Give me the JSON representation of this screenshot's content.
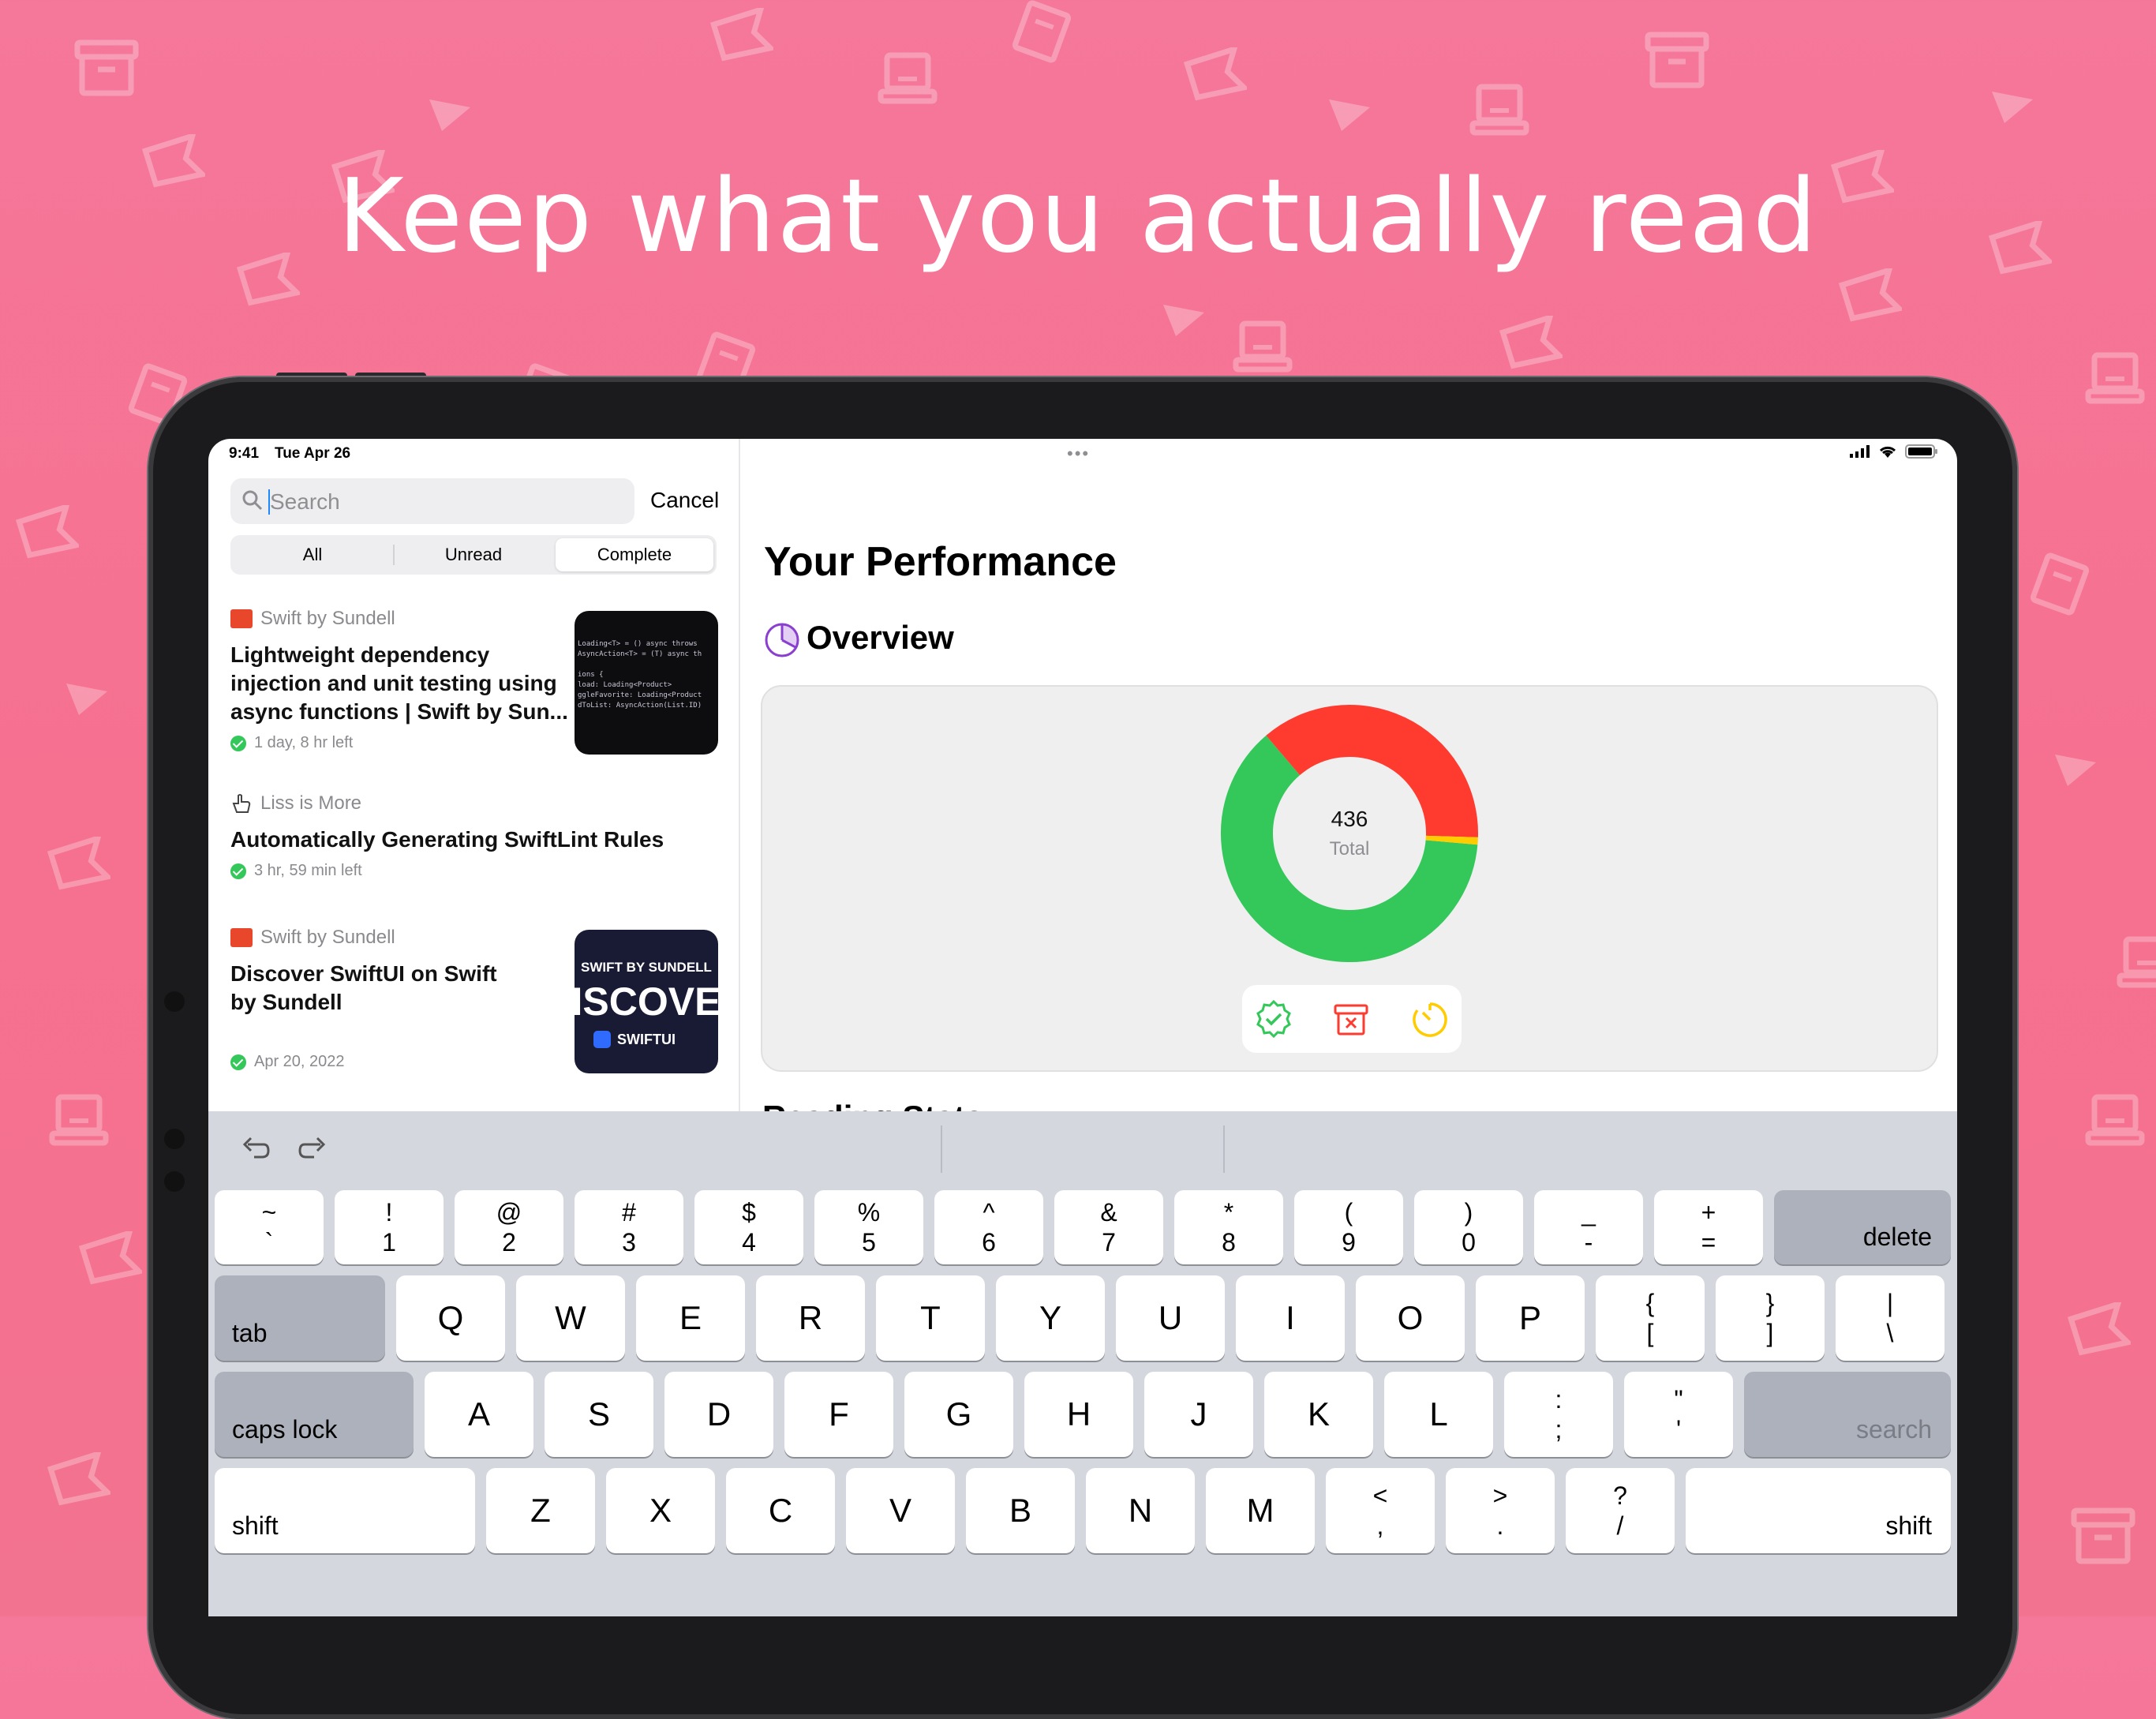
{
  "headline": "Keep what you actually read",
  "status_bar": {
    "time": "9:41",
    "date": "Tue Apr 26",
    "center_dots": "•••"
  },
  "search": {
    "placeholder": "Search",
    "cancel_label": "Cancel"
  },
  "segments": [
    {
      "label": "All",
      "active": false
    },
    {
      "label": "Unread",
      "active": false
    },
    {
      "label": "Complete",
      "active": true
    }
  ],
  "articles": [
    {
      "source": "Swift by Sundell",
      "title_lines": [
        "Lightweight dependency",
        "injection and unit testing using",
        "async functions | Swift by Sun..."
      ],
      "meta": "1 day, 8 hr left",
      "thumb_code": "Loading<T> = () async throws\nAsyncAction<T> = (T) async th\n\nions {\nload: Loading<Product>\nggleFavorite: Loading<Product\ndToList: AsyncAction(List.ID)"
    },
    {
      "source": "Liss is More",
      "title_lines": [
        "Automatically Generating SwiftLint Rules"
      ],
      "meta": "3 hr, 59 min left"
    },
    {
      "source": "Swift by Sundell",
      "title_lines": [
        "Discover SwiftUI on Swift",
        "by Sundell"
      ],
      "meta": "Apr 20, 2022",
      "thumb_top": "SWIFT BY SUNDELL",
      "thumb_big": "ISCOVE",
      "thumb_bottom": "SWIFTUI"
    }
  ],
  "detail": {
    "title": "Your Performance",
    "overview_title": "Overview",
    "donut_total": "436",
    "donut_label": "Total",
    "peek_title": "Reading Stats"
  },
  "chart_data": {
    "type": "pie",
    "categories": [
      "Completed",
      "Deleted",
      "Expired"
    ],
    "values": [
      272,
      160,
      4
    ],
    "total": 436,
    "colors": [
      "#34c759",
      "#ff3b30",
      "#ffcc00"
    ]
  },
  "keyboard": {
    "number_row": [
      {
        "top": "~",
        "bottom": "`"
      },
      {
        "top": "!",
        "bottom": "1"
      },
      {
        "top": "@",
        "bottom": "2"
      },
      {
        "top": "#",
        "bottom": "3"
      },
      {
        "top": "$",
        "bottom": "4"
      },
      {
        "top": "%",
        "bottom": "5"
      },
      {
        "top": "^",
        "bottom": "6"
      },
      {
        "top": "&",
        "bottom": "7"
      },
      {
        "top": "*",
        "bottom": "8"
      },
      {
        "top": "(",
        "bottom": "9"
      },
      {
        "top": ")",
        "bottom": "0"
      },
      {
        "top": "_",
        "bottom": "-"
      },
      {
        "top": "+",
        "bottom": "="
      }
    ],
    "delete": "delete",
    "tab": "tab",
    "row_q": [
      "Q",
      "W",
      "E",
      "R",
      "T",
      "Y",
      "U",
      "I",
      "O",
      "P"
    ],
    "row_q_extra": [
      {
        "top": "{",
        "bottom": "["
      },
      {
        "top": "}",
        "bottom": "]"
      },
      {
        "top": "|",
        "bottom": "\\"
      }
    ],
    "caps": "caps lock",
    "row_a": [
      "A",
      "S",
      "D",
      "F",
      "G",
      "H",
      "J",
      "K",
      "L"
    ],
    "row_a_extra": [
      {
        "top": ":",
        "bottom": ";"
      },
      {
        "top": "\"",
        "bottom": "'"
      }
    ],
    "search": "search",
    "shift_left": "shift",
    "row_z": [
      "Z",
      "X",
      "C",
      "V",
      "B",
      "N",
      "M"
    ],
    "row_z_extra": [
      {
        "top": "<",
        "bottom": ","
      },
      {
        "top": ">",
        "bottom": "."
      },
      {
        "top": "?",
        "bottom": "/"
      }
    ],
    "shift_right": "shift"
  }
}
